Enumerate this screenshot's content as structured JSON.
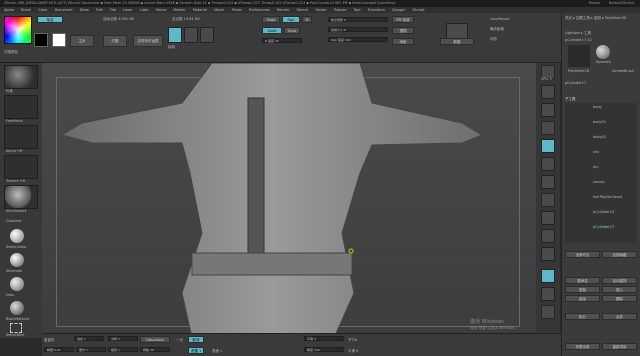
{
  "title": "ZBrush 4R8 [DESK-G6MP-V6TI-AJ3T]  ZBrush Document  ▪ Free Mem 10.958GB ▪ Active Mem 2948 ▪ Scratch Disk 41 ▪ Timer▸0.019 ▪ ATime▸0.027 Time▸0.163 ATime▸0.023 ▪ PolyCount▸14.961 MP ▪ MeshCount▸6  QuickSave",
  "title_right": [
    "Menus",
    "DefaultZScript"
  ],
  "menus": [
    "Alpha",
    "Brush",
    "Color",
    "Document",
    "Draw",
    "Edit",
    "File",
    "Layer",
    "Light",
    "Macro",
    "Marker",
    "Material",
    "Movie",
    "Picker",
    "Preferences",
    "Render",
    "Stencil",
    "Stroke",
    "Texture",
    "Tool",
    "Transform",
    "Zplugin",
    "Zscript"
  ],
  "shelf": {
    "label_left": "切換颜色",
    "btn_gradient": "渐变",
    "btn_main": "主页",
    "btn_lightbox": "灯箱",
    "btn_liveboolean": "实时布尔运算",
    "quicksketch_label": "绘制",
    "stats1": "活动点数 4.091 Mil",
    "stats2": "总点数 14.94 Mil",
    "mrgb": "Mrgb",
    "rgb": "Rgb",
    "m": "M",
    "rgb_intensity": "Rgb 强度 100",
    "zadd": "Zadd",
    "zsub": "Zsub",
    "zcut": "Zcut",
    "z_intensity": "Z 强度 25",
    "focal_shift": "焦点调整 0",
    "draw_size": "绘制大小 6",
    "dynamic": "Dynamic",
    "active_points": "PM 系统",
    "persp": "透视",
    "floor": "地板",
    "lsym": "LazyMouse",
    "lazy_radius": "懒步距离",
    "backface": "新建",
    "dyn_label": "动态"
  },
  "left_tools": [
    {
      "name": "Standard",
      "label": "标准"
    },
    {
      "name": "FreeHand",
      "label": "FreeHand"
    },
    {
      "name": "Alpha Off",
      "label": "Alpha Off"
    },
    {
      "name": "Texture Off",
      "label": "Texture Off"
    },
    {
      "name": "SkinShade4",
      "label": "SkinShade4"
    }
  ],
  "left_lower": [
    "Gradient",
    "SwitchColor",
    "Alternate",
    "Dots",
    "BasicMaterial",
    "SkinShade4",
    "Default",
    "SelectRect"
  ],
  "right_buttons": [
    "BPR",
    "SPix 3",
    "Scroll",
    "Zoom",
    "Actual",
    "AAHalf",
    "Dynamic",
    "Persp",
    "Floor",
    "Local",
    "LSym",
    "Gxyz",
    "Frame",
    "Move",
    "Scale",
    "Rotate",
    "Line Fill",
    "PolyF",
    "Transp",
    "Ghost",
    "Solo",
    "Xpose"
  ],
  "subtool": {
    "header": "亮光 ▸ 加载工具 ▸ 复制 ▸ PolyMesh3D",
    "lightbox": "Lightbox ▸ 工具",
    "current": "pCylinder17 42",
    "thumbs": [
      "SphereA",
      "Cylinder3D",
      "PolyMesh3D",
      "SimpleBrush",
      "pCylinder17"
    ],
    "section": "子工具",
    "items": [
      "body",
      "body01",
      "body02",
      "yifu",
      "pin",
      "yaoqiu",
      "hairPolySurface4",
      "pCylinder15",
      "pCylinder17"
    ],
    "bottom_rows": [
      [
        "全部可见",
        "全部隐藏"
      ],
      [
        "重命名",
        "自动重排"
      ],
      [
        "复制",
        "插入"
      ],
      [
        "追加",
        "删除"
      ],
      [
        "拆分",
        "合并"
      ],
      [
        "列表全部",
        "重新排序"
      ]
    ]
  },
  "bottom": {
    "row1": [
      "重量布",
      "动态 1",
      "对称 X",
      "Obsurface",
      "一点",
      "取消",
      "平滑 4",
      "子T/d"
    ],
    "row2": [
      "精细 0.01",
      "迭代 1",
      "插值 1",
      "网格 20",
      "遮罩 1",
      "表面 1",
      "精度 100",
      "平滑 4"
    ]
  },
  "watermark": [
    "激活 Windows",
    "转到\"设置\"以激活 Windows。"
  ],
  "colors": {
    "accent": "#5fb8c9",
    "panel": "#3a3a3a",
    "dark": "#2a2a2a",
    "model": "#8a8a8a"
  }
}
